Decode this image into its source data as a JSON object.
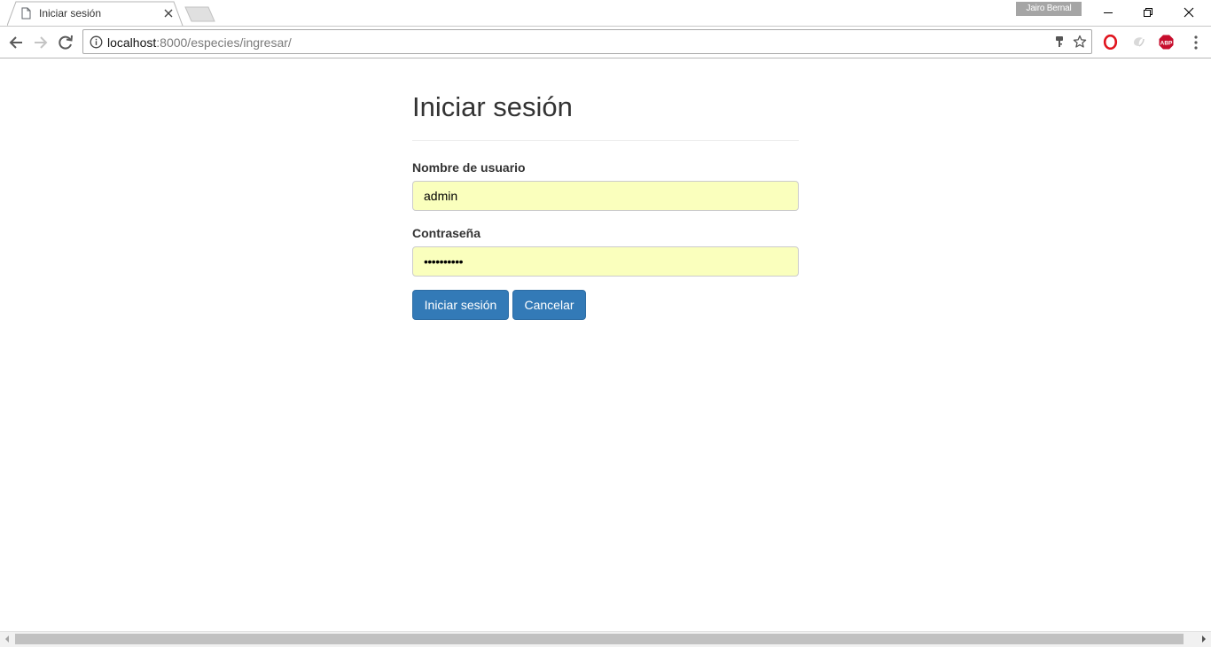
{
  "browser": {
    "tab_title": "Iniciar sesión",
    "profile_name": "Jairo Bernal",
    "url_host": "localhost",
    "url_path": ":8000/especies/ingresar/",
    "extensions": [
      {
        "name": "Opera",
        "icon": "opera-icon"
      },
      {
        "name": "Extension",
        "icon": "extension-icon"
      },
      {
        "name": "AdBlock Plus",
        "icon": "abp-icon",
        "label": "ABP"
      }
    ]
  },
  "login": {
    "title": "Iniciar sesión",
    "username_label": "Nombre de usuario",
    "username_value": "admin",
    "password_label": "Contraseña",
    "password_value": "••••••••••",
    "submit_label": "Iniciar sesión",
    "cancel_label": "Cancelar"
  },
  "colors": {
    "primary_button": "#337ab7",
    "autofill_background": "#faffbd"
  }
}
